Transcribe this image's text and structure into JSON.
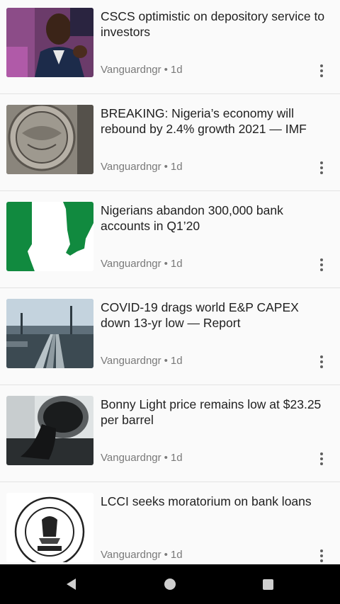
{
  "feed": {
    "items": [
      {
        "title": "CSCS optimistic on depository service to investors",
        "source": "Vanguardngr",
        "separator": "•",
        "age": "1d",
        "image": "man-in-suit-photo"
      },
      {
        "title": "BREAKING: Nigeria’s economy will rebound by 2.4% growth 2021 — IMF",
        "source": "Vanguardngr",
        "separator": "•",
        "age": "1d",
        "image": "imf-seal-photo"
      },
      {
        "title": "Nigerians abandon 300,000 bank accounts in Q1’20",
        "source": "Vanguardngr",
        "separator": "•",
        "age": "1d",
        "image": "nigeria-map-flag"
      },
      {
        "title": "COVID-19 drags world E&P CAPEX down 13-yr low  — Report",
        "source": "Vanguardngr",
        "separator": "•",
        "age": "1d",
        "image": "oil-pipeline-photo"
      },
      {
        "title": "Bonny Light price remains low at $23.25 per barrel",
        "source": "Vanguardngr",
        "separator": "•",
        "age": "1d",
        "image": "oil-barrel-photo"
      },
      {
        "title": "LCCI seeks moratorium on bank loans",
        "source": "Vanguardngr",
        "separator": "•",
        "age": "1d",
        "image": "lcci-logo"
      }
    ]
  },
  "navbar": {
    "back_icon": "back-triangle-icon",
    "home_icon": "home-circle-icon",
    "recents_icon": "recents-square-icon"
  },
  "colors": {
    "background": "#fafafa",
    "title": "#1f1f1f",
    "meta": "#7a7a7a",
    "navbar": "#000000",
    "nigeria_green": "#118a3f"
  }
}
